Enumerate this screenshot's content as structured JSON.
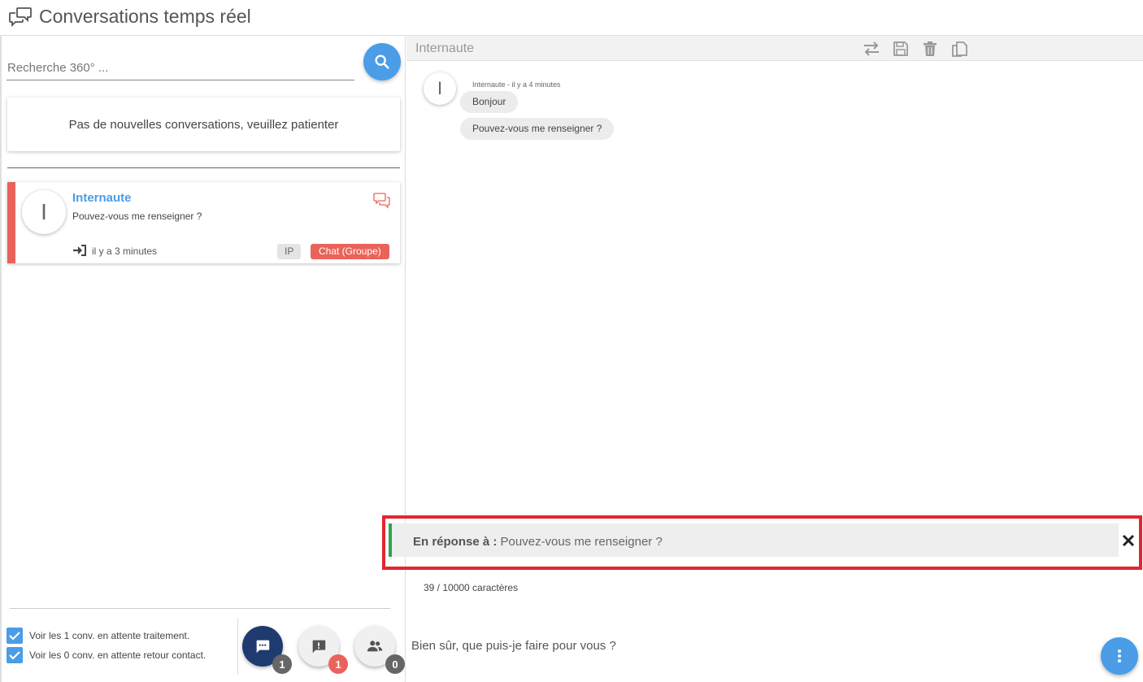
{
  "header": {
    "title": "Conversations temps réel",
    "icon": "chat-bubbles-icon"
  },
  "search": {
    "placeholder": "Recherche 360° ...",
    "value": ""
  },
  "empty_state": {
    "text": "Pas de nouvelles conversations, veuillez patienter"
  },
  "conversations": [
    {
      "avatar_initial": "I",
      "name": "Internaute",
      "preview": "Pouvez-vous me renseigner ?",
      "time": "il y a 3 minutes",
      "tags": [
        "IP",
        "Chat (Groupe)"
      ],
      "accent_color": "#e9635a"
    }
  ],
  "filters": [
    {
      "label": "Voir les 1 conv. en attente traitement.",
      "checked": true
    },
    {
      "label": "Voir les 0 conv. en attente retour contact.",
      "checked": true
    }
  ],
  "fab_counts": {
    "chats": "1",
    "alerts": "1",
    "groups": "0"
  },
  "chat": {
    "title": "Internaute",
    "avatar_initial": "I",
    "meta": "Internaute - il y a 4 minutes",
    "messages": [
      "Bonjour",
      "Pouvez-vous me renseigner ?"
    ],
    "reply": {
      "label": "En réponse à :",
      "quoted": "Pouvez-vous me renseigner ?"
    },
    "char_count": "39 / 10000 caractères",
    "compose_value": "Bien sûr, que puis-je faire pour vous ?"
  },
  "colors": {
    "primary": "#4a9de6",
    "accent_red": "#e9635a",
    "dark_navy": "#1f3a6e",
    "highlight_border": "#e3262f",
    "reply_green": "#2ea44f"
  }
}
